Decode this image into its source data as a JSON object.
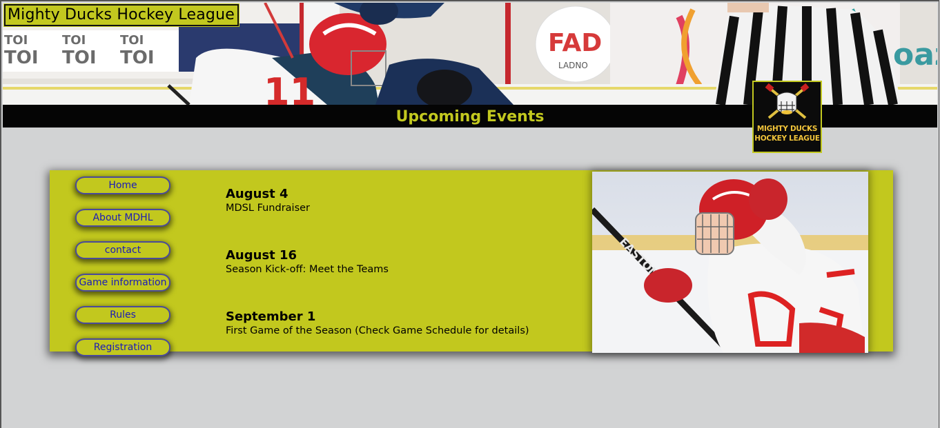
{
  "site": {
    "title": "Mighty Ducks Hockey League",
    "section_heading": "Upcoming Events",
    "logo_text_line1": "MIGHTY DUCKS",
    "logo_text_line2": "HOCKEY LEAGUE"
  },
  "nav": {
    "items": [
      {
        "label": "Home"
      },
      {
        "label": "About MDHL"
      },
      {
        "label": "contact"
      },
      {
        "label": "Game information"
      },
      {
        "label": "Rules"
      },
      {
        "label": "Registration"
      }
    ]
  },
  "events": [
    {
      "date": "August 4",
      "description": "MDSL Fundraiser"
    },
    {
      "date": "August 16",
      "description": "Season Kick-off: Meet the Teams"
    },
    {
      "date": "September 1",
      "description": "First Game of the Season (Check Game Schedule for details)"
    }
  ],
  "colors": {
    "accent": "#c2c81e",
    "page_background": "#d2d3d4",
    "bar_background": "#050505",
    "nav_text": "#1a1ab8"
  }
}
